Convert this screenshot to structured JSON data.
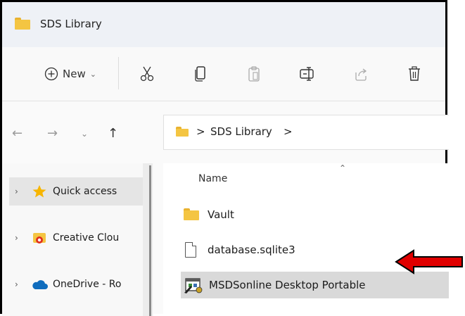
{
  "window": {
    "title": "SDS Library"
  },
  "toolbar": {
    "new_label": "New",
    "buttons": [
      "new",
      "cut",
      "copy",
      "paste",
      "rename",
      "share",
      "delete"
    ],
    "icons": {
      "new": "plus-circle-icon",
      "cut": "scissors-icon",
      "copy": "copy-icon",
      "paste": "paste-icon",
      "rename": "rename-icon",
      "share": "share-icon",
      "delete": "trash-icon"
    }
  },
  "nav": {
    "breadcrumb": [
      "SDS Library"
    ],
    "separator": ">"
  },
  "sidebar": {
    "items": [
      {
        "label": "Quick access",
        "icon": "star-icon"
      },
      {
        "label": "Creative Clou",
        "icon": "creative-cloud-folder-icon"
      },
      {
        "label": "OneDrive - Ro",
        "icon": "onedrive-cloud-icon"
      }
    ]
  },
  "content": {
    "column_name": "Name",
    "files": [
      {
        "name": "Vault",
        "icon": "folder-icon"
      },
      {
        "name": "database.sqlite3",
        "icon": "document-icon"
      },
      {
        "name": "MSDSonline Desktop Portable",
        "icon": "application-icon"
      }
    ]
  },
  "colors": {
    "accent_arrow": "#e00000",
    "folder": "#f4c542",
    "selection": "#d9d9d9",
    "star": "#f7b500",
    "onedrive": "#0f6cbd"
  }
}
